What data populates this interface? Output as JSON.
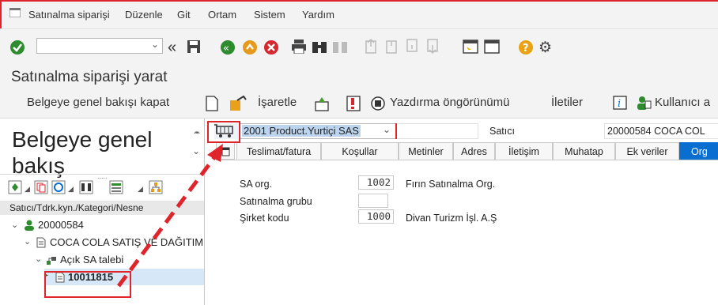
{
  "menu": {
    "items": [
      "Satınalma siparişi",
      "Düzenle",
      "Git",
      "Ortam",
      "Sistem",
      "Yardım"
    ]
  },
  "title": "Satınalma siparişi yarat",
  "app_toolbar": {
    "overview_close": "Belgeye genel bakışı kapat",
    "mark": "İşaretle",
    "print_preview": "Yazdırma öngörünümü",
    "messages": "İletiler",
    "user": "Kullanıcı a"
  },
  "left": {
    "heading_line1": "Belgeye genel",
    "heading_line2": "bakış",
    "column_header": "Satıcı/Tdrk.kyn./Kategori/Nesne",
    "tree": {
      "vendor": "20000584",
      "company": "COCA COLA SATIŞ VE DAĞITIM",
      "open_req": "Açık SA talebi",
      "doc": "10011815"
    }
  },
  "header": {
    "doc_type": "2001 Product.Yurtiçi SAS",
    "vendor_label": "Satıcı",
    "vendor_value": "20000584 COCA COL"
  },
  "tabs": [
    "Teslimat/fatura",
    "Koşullar",
    "Metinler",
    "Adres",
    "İletişim",
    "Muhatap",
    "Ek veriler",
    "Org"
  ],
  "org": {
    "sa_org_label": "SA org.",
    "sa_org_value": "1002",
    "sa_org_text": "Fırın Satınalma Org.",
    "group_label": "Satınalma grubu",
    "group_value": "",
    "company_label": "Şirket kodu",
    "company_value": "1000",
    "company_text": "Divan Turizm İşl. A.Ş"
  },
  "colors": {
    "accent": "#0a6ed1",
    "annotation_red": "#e0242b",
    "ok_green": "#2e8b2e"
  }
}
